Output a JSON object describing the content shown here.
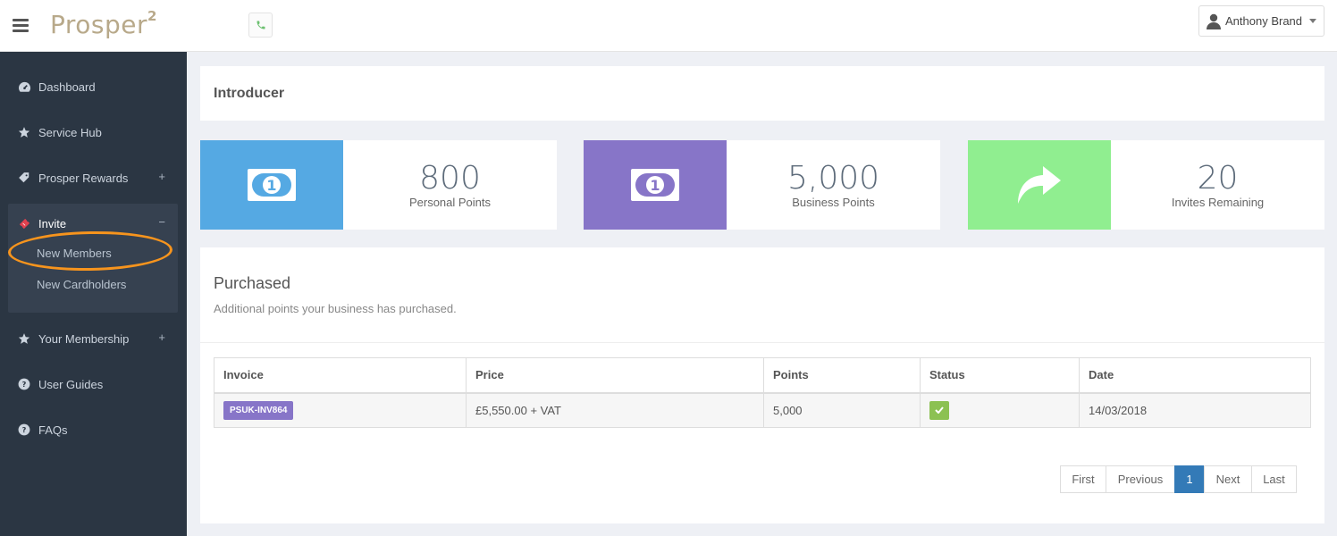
{
  "app": {
    "logo": "Prosper",
    "logo_sup": "2"
  },
  "header": {
    "user_name": "Anthony Brand"
  },
  "sidebar": {
    "items": [
      {
        "label": "Dashboard"
      },
      {
        "label": "Service Hub"
      },
      {
        "label": "Prosper Rewards",
        "toggle": "+"
      },
      {
        "label": "Invite",
        "toggle": "−"
      },
      {
        "label": "Your Membership",
        "toggle": "+"
      },
      {
        "label": "User Guides"
      },
      {
        "label": "FAQs"
      }
    ],
    "invite_sub": [
      {
        "label": "New Members"
      },
      {
        "label": "New Cardholders"
      }
    ]
  },
  "page": {
    "title": "Introducer"
  },
  "stats": [
    {
      "value": "800",
      "label": "Personal Points",
      "color": "#55a9e3"
    },
    {
      "value": "5,000",
      "label": "Business Points",
      "color": "#8775c8"
    },
    {
      "value": "20",
      "label": "Invites Remaining",
      "color": "#90ee90"
    }
  ],
  "purchased": {
    "title": "Purchased",
    "subtitle": "Additional points your business has purchased.",
    "columns": [
      "Invoice",
      "Price",
      "Points",
      "Status",
      "Date"
    ],
    "rows": [
      {
        "invoice": "PSUK-INV864",
        "price": "£5,550.00 + VAT",
        "points": "5,000",
        "status": "paid",
        "date": "14/03/2018"
      }
    ],
    "pagination": {
      "first": "First",
      "previous": "Previous",
      "current": "1",
      "next": "Next",
      "last": "Last"
    }
  }
}
